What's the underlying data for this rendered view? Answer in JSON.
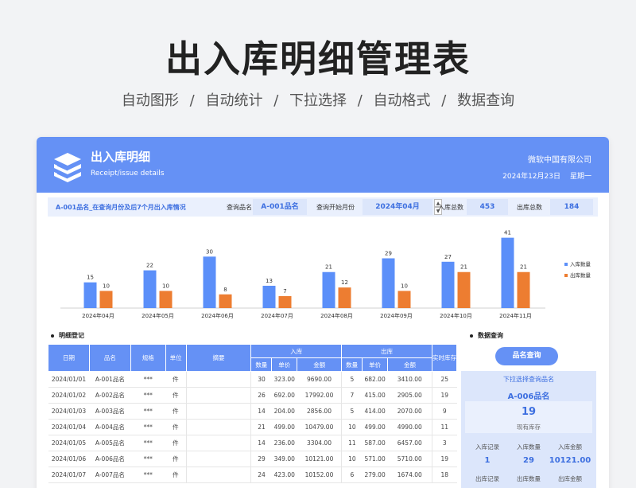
{
  "page": {
    "title": "出入库明细管理表",
    "features": [
      "自动图形",
      "/",
      "自动统计",
      "/",
      "下拉选择",
      "/",
      "自动格式",
      "/",
      "数据查询"
    ]
  },
  "header": {
    "title": "出入库明细",
    "subtitle": "Receipt/issue details",
    "company": "微软中国有限公司",
    "date": "2024年12月23日",
    "weekday": "星期一",
    "logo": "books-icon"
  },
  "query_bar": {
    "description": "A-001品名_在查询月份及后7个月出入库情况",
    "product_label": "查询品名",
    "product_value": "A-001品名",
    "month_label": "查询开始月份",
    "month_value": "2024年04月",
    "in_total_label": "入库总数",
    "in_total_value": "453",
    "out_total_label": "出库总数",
    "out_total_value": "184"
  },
  "chart_data": {
    "type": "bar",
    "categories": [
      "2024年04月",
      "2024年05月",
      "2024年06月",
      "2024年07月",
      "2024年08月",
      "2024年09月",
      "2024年10月",
      "2024年11月"
    ],
    "series": [
      {
        "name": "入库数量",
        "values": [
          15,
          22,
          30,
          13,
          21,
          29,
          27,
          41
        ],
        "color": "#5b8ff9"
      },
      {
        "name": "出库数量",
        "values": [
          10,
          10,
          8,
          7,
          12,
          10,
          21,
          21
        ],
        "color": "#ed7d31"
      }
    ],
    "ylim": [
      0,
      45
    ],
    "legend": "right",
    "grid": false
  },
  "detail": {
    "section_title": "明细登记",
    "headers": {
      "date": "日期",
      "name": "品名",
      "spec": "规格",
      "unit": "单位",
      "memo": "摘要",
      "in": "入库",
      "out": "出库",
      "stock": "实时库存",
      "qty": "数量",
      "price": "单价",
      "amount": "金额"
    },
    "rows": [
      [
        "2024/01/01",
        "A-001品名",
        "***",
        "件",
        "",
        "30",
        "323.00",
        "9690.00",
        "5",
        "682.00",
        "3410.00",
        "25"
      ],
      [
        "2024/01/02",
        "A-002品名",
        "***",
        "件",
        "",
        "26",
        "692.00",
        "17992.00",
        "7",
        "415.00",
        "2905.00",
        "19"
      ],
      [
        "2024/01/03",
        "A-003品名",
        "***",
        "件",
        "",
        "14",
        "204.00",
        "2856.00",
        "5",
        "414.00",
        "2070.00",
        "9"
      ],
      [
        "2024/01/04",
        "A-004品名",
        "***",
        "件",
        "",
        "21",
        "499.00",
        "10479.00",
        "10",
        "499.00",
        "4990.00",
        "11"
      ],
      [
        "2024/01/05",
        "A-005品名",
        "***",
        "件",
        "",
        "14",
        "236.00",
        "3304.00",
        "11",
        "587.00",
        "6457.00",
        "3"
      ],
      [
        "2024/01/06",
        "A-006品名",
        "***",
        "件",
        "",
        "29",
        "349.00",
        "10121.00",
        "10",
        "571.00",
        "5710.00",
        "19"
      ],
      [
        "2024/01/07",
        "A-007品名",
        "***",
        "件",
        "",
        "24",
        "423.00",
        "10152.00",
        "6",
        "279.00",
        "1674.00",
        "18"
      ]
    ]
  },
  "query_panel": {
    "section_title": "数据查询",
    "button": "品名查询",
    "hint": "下拉选择查询品名",
    "product": "A-006品名",
    "stock_value": "19",
    "stock_label": "现有库存",
    "in_records_label": "入库记录",
    "in_records_value": "1",
    "in_qty_label": "入库数量",
    "in_qty_value": "29",
    "in_amount_label": "入库金额",
    "in_amount_value": "10121.00",
    "out_records_label": "出库记录",
    "out_qty_label": "出库数量",
    "out_amount_label": "出库金额"
  }
}
